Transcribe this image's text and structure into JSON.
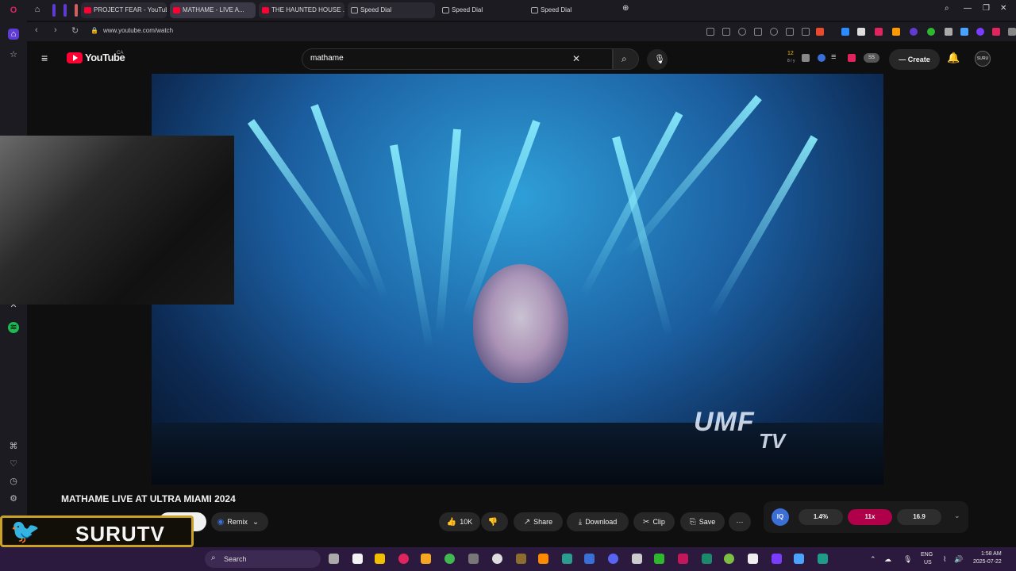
{
  "browser": {
    "tabs": [
      {
        "label": "PROJECT FEAR - YouTube",
        "icon": "youtube-icon"
      },
      {
        "label": "MATHAME - LIVE A...",
        "icon": "youtube-icon"
      },
      {
        "label": "THE HAUNTED HOUSE ...",
        "icon": "youtube-icon"
      },
      {
        "label": "Speed Dial",
        "icon": "speed-dial-icon"
      },
      {
        "label": "Speed Dial",
        "icon": "speed-dial-icon"
      },
      {
        "label": "Speed Dial",
        "icon": "speed-dial-icon"
      }
    ],
    "url": "www.youtube.com/watch"
  },
  "youtube": {
    "logo_text": "YouTube",
    "region": "CA",
    "search_value": "mathame",
    "create_label": "Create",
    "header_badge": "12",
    "header_badge_sub": "8 / y",
    "avatar_text": "SURU"
  },
  "video": {
    "watermark": "UMF",
    "watermark_sub": "TV",
    "title": "MATHAME LIVE AT ULTRA MIAMI 2024"
  },
  "actions": {
    "remix": "Remix",
    "likes": "10K",
    "share": "Share",
    "download": "Download",
    "clip": "Clip",
    "save": "Save",
    "more": "⋯"
  },
  "stats_widget": {
    "logo": "IQ",
    "values": [
      "1.4%",
      "11x",
      "16.9"
    ],
    "colors": [
      "#2e2e2e",
      "#b0004a",
      "#2e2e2e"
    ]
  },
  "overlay": {
    "brand": "SURUTV"
  },
  "taskbar": {
    "search_placeholder": "Search",
    "lang": "ENG",
    "region": "US",
    "time": "1:58 AM",
    "date": "2025-07-22"
  }
}
